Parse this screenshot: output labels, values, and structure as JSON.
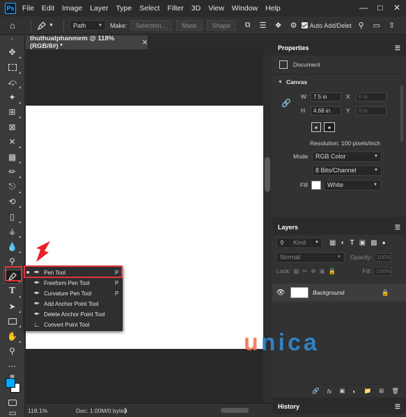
{
  "menubar": {
    "logo": "Ps",
    "items": [
      "File",
      "Edit",
      "Image",
      "Layer",
      "Type",
      "Select",
      "Filter",
      "3D",
      "View",
      "Window",
      "Help"
    ],
    "controls": [
      "minimize-icon",
      "maximize-icon",
      "close-icon"
    ]
  },
  "options": {
    "mode_value": "Path",
    "make_label": "Make:",
    "selection_button": "Selection...",
    "mask_button": "Mask",
    "shape_button": "Shape",
    "auto_add_delete": "Auto Add/Delet"
  },
  "document": {
    "tab_title": "thuthuatphanmem @ 118% (RGB/8#) *",
    "zoom": "118.1%",
    "doc_info": "Doc: 1.00M/0 bytes"
  },
  "flyout": {
    "items": [
      {
        "label": "Pen Tool",
        "shortcut": "P",
        "icon": "pen-icon",
        "selected": true
      },
      {
        "label": "Freeform Pen Tool",
        "shortcut": "P",
        "icon": "freeform-pen-icon",
        "selected": false
      },
      {
        "label": "Curvature Pen Tool",
        "shortcut": "P",
        "icon": "curvature-pen-icon",
        "selected": false
      },
      {
        "label": "Add Anchor Point Tool",
        "shortcut": "",
        "icon": "add-anchor-icon",
        "selected": false
      },
      {
        "label": "Delete Anchor Point Tool",
        "shortcut": "",
        "icon": "delete-anchor-icon",
        "selected": false
      },
      {
        "label": "Convert Point Tool",
        "shortcut": "",
        "icon": "convert-point-icon",
        "selected": false
      }
    ]
  },
  "properties": {
    "tab_title": "Properties",
    "doc_label": "Document",
    "canvas_label": "Canvas",
    "w_label": "W",
    "w_value": "7.5 in",
    "x_label": "X",
    "x_value": "0 in",
    "h_label": "H",
    "h_value": "4.68 in",
    "y_label": "Y",
    "y_value": "0 in",
    "resolution": "Resolution: 100 pixels/inch",
    "mode_label": "Mode",
    "mode_value": "RGB Color",
    "bits_value": "8 Bits/Channel",
    "fill_label": "Fill",
    "fill_value": "White"
  },
  "layers": {
    "tab_title": "Layers",
    "filter_kind": "Kind",
    "blend_mode": "Normal",
    "opacity_label": "Opacity:",
    "opacity_value": "100%",
    "lock_label": "Lock:",
    "fill_label": "Fill:",
    "fill_value": "100%",
    "layer_name": "Background"
  },
  "history": {
    "tab_title": "History"
  },
  "watermark": {
    "first": "u",
    "rest": "nica"
  },
  "colors": {
    "foreground": "#00aaff",
    "background": "#ffffff",
    "highlight": "#e0343c"
  }
}
